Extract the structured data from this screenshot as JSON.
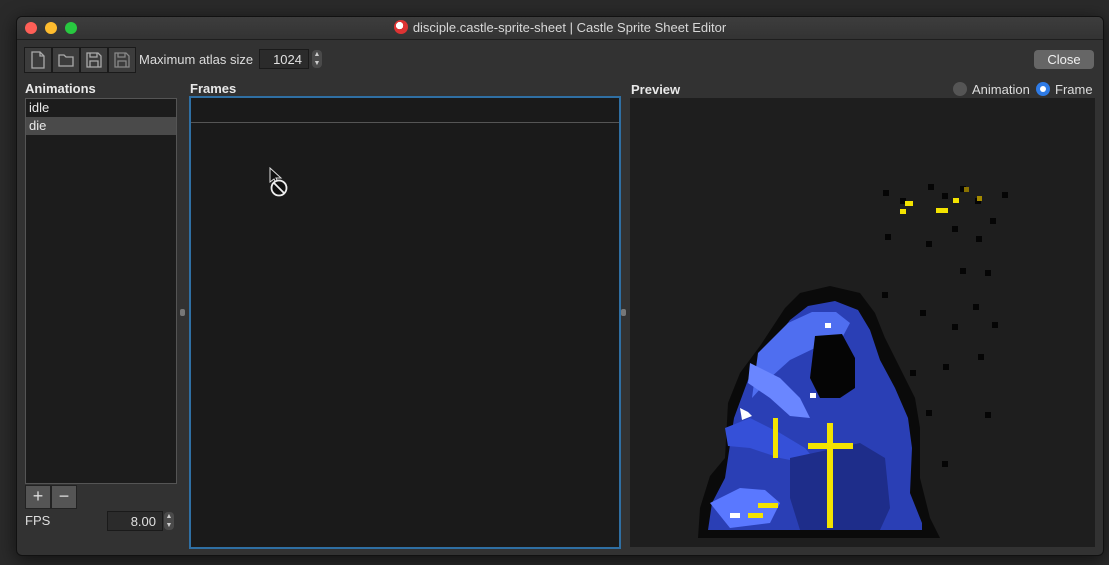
{
  "window": {
    "title": "disciple.castle-sprite-sheet | Castle Sprite Sheet Editor"
  },
  "toolbar": {
    "buttons": [
      {
        "icon": "new-file-icon"
      },
      {
        "icon": "open-folder-icon"
      },
      {
        "icon": "save-icon"
      },
      {
        "icon": "save-as-icon"
      }
    ],
    "atlas_label": "Maximum atlas size",
    "atlas_value": "1024",
    "close_label": "Close"
  },
  "animations": {
    "title": "Animations",
    "items": [
      "idle",
      "die"
    ],
    "selected_index": 1,
    "add_label": "+",
    "remove_label": "−",
    "fps_label": "FPS",
    "fps_value": "8.00"
  },
  "frames": {
    "title": "Frames"
  },
  "preview": {
    "title": "Preview",
    "mode_options": [
      "Animation",
      "Frame"
    ],
    "selected_mode": "Frame"
  },
  "colors": {
    "accent": "#2e7be6",
    "frames_border": "#2f6fa3",
    "sprite_blue": "#3b54d6",
    "sprite_yellow": "#f3e300"
  }
}
